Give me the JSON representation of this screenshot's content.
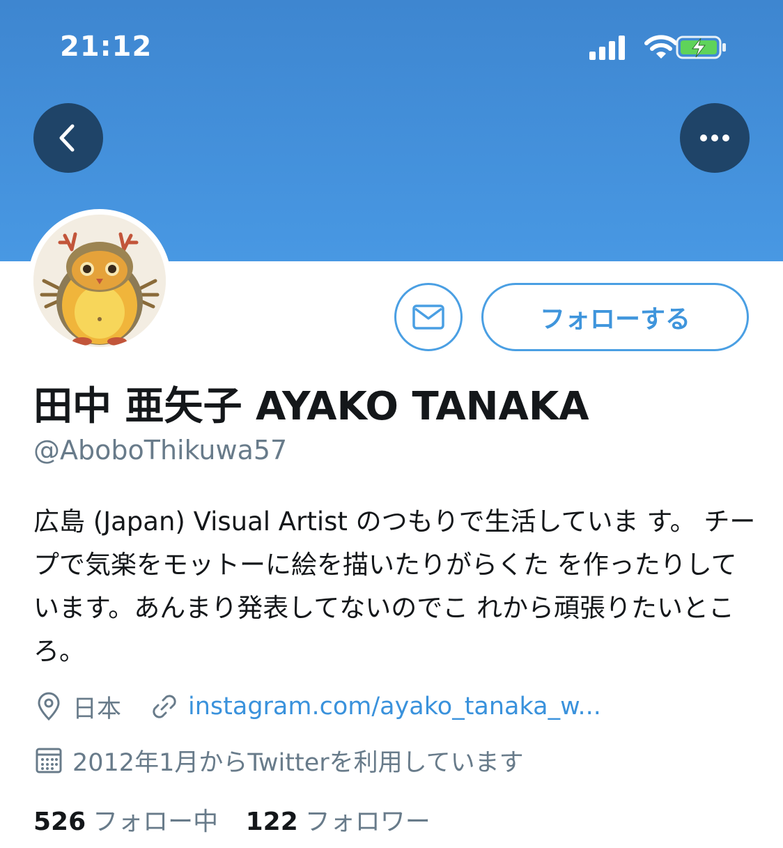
{
  "status_bar": {
    "time": "21:12",
    "icons": [
      "signal-icon",
      "wifi-icon",
      "battery-charging-icon"
    ]
  },
  "profile": {
    "display_name": "田中 亜矢子  AYAKO TANAKA",
    "handle": "@AboboThikuwa57",
    "bio": "広島 (Japan) Visual Artist のつもりで生活していま す。 チープで気楽をモットーに絵を描いたりがらくた を作ったりしています。あんまり発表してないのでこ れから頑張りたいところ。",
    "location": "日本",
    "website": "instagram.com/ayako_tanaka_w...",
    "joined": "2012年1月からTwitterを利用しています"
  },
  "actions": {
    "follow_label": "フォローする",
    "back_icon": "chevron-left-icon",
    "more_icon": "more-horizontal-icon",
    "message_icon": "envelope-icon"
  },
  "stats": {
    "following_count": "526",
    "following_label": "フォロー中",
    "followers_count": "122",
    "followers_label": "フォロワー"
  },
  "colors": {
    "banner_top": "#3e86d0",
    "banner_bottom": "#4898e3",
    "accent": "#4a9fe3",
    "secondary_text": "#687b8a"
  }
}
